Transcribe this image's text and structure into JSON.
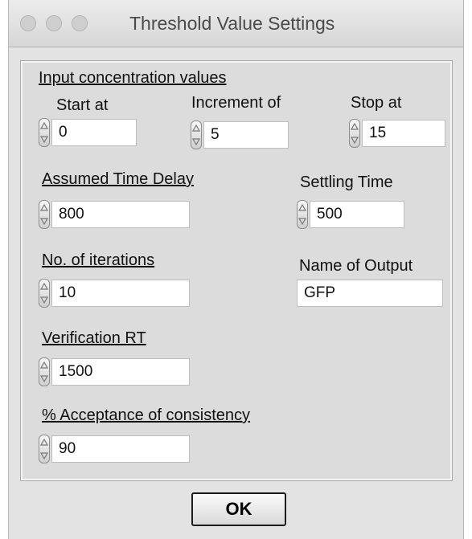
{
  "window": {
    "title": "Threshold Value Settings"
  },
  "panel": {
    "heading": "Input concentration values",
    "start": {
      "label": "Start at",
      "value": "0"
    },
    "increment": {
      "label": "Increment of",
      "value": "5"
    },
    "stop": {
      "label": "Stop at",
      "value": "15"
    },
    "time_delay": {
      "label": "Assumed Time Delay",
      "value": "800"
    },
    "settling_time": {
      "label": "Settling Time",
      "value": "500"
    },
    "iterations": {
      "label": "No. of iterations",
      "value": "10"
    },
    "output_name": {
      "label": "Name of Output",
      "value": "GFP"
    },
    "verification_rt": {
      "label": "Verification RT",
      "value": "1500"
    },
    "acceptance": {
      "label": "% Acceptance of consistency",
      "value": "90"
    }
  },
  "buttons": {
    "ok": "OK"
  },
  "icons": {
    "spinner": "up-down-spinner-icon"
  }
}
